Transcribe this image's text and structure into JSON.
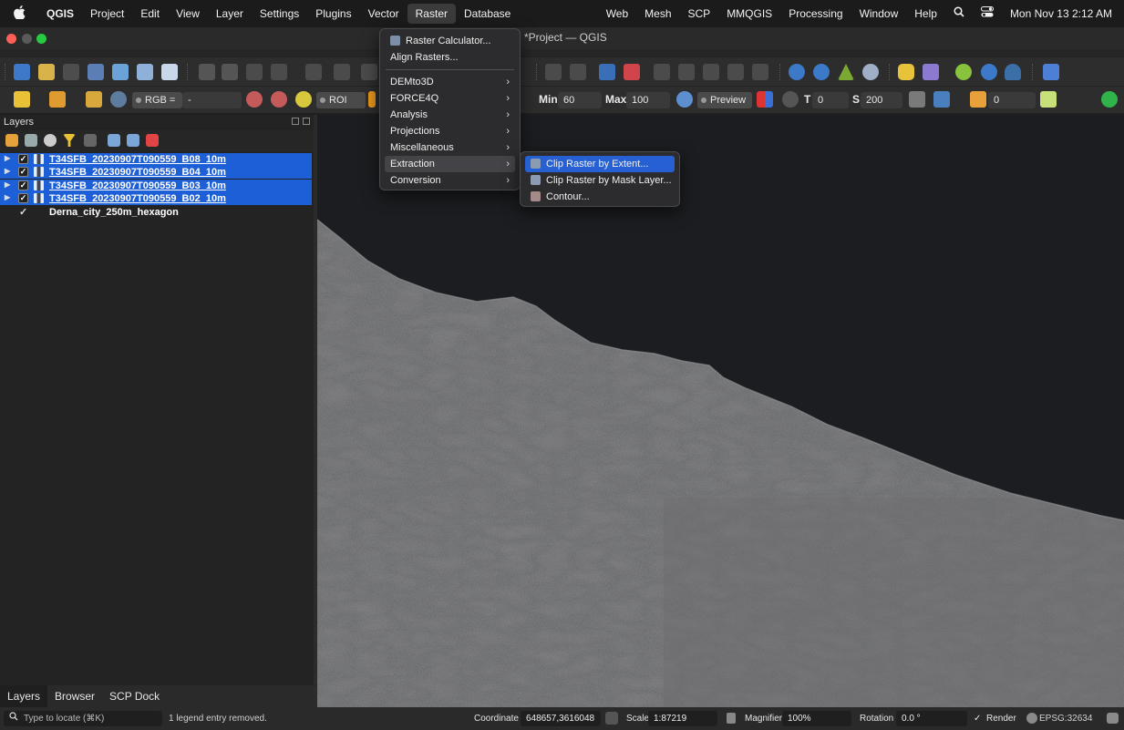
{
  "menubar": {
    "apple": "",
    "app": "QGIS",
    "items": [
      "Project",
      "Edit",
      "View",
      "Layer",
      "Settings",
      "Plugins",
      "Vector",
      "Raster",
      "Database"
    ],
    "right_items": [
      "Web",
      "Mesh",
      "SCP",
      "MMQGIS",
      "Processing",
      "Window",
      "Help"
    ],
    "clock": "Mon Nov 13  2:12 AM"
  },
  "window": {
    "title": "*Project — QGIS"
  },
  "toolbar3": {
    "rgb_label": "RGB =",
    "rgb_value": "-",
    "roi_label": "ROI",
    "min_label": "Min",
    "min_value": "60",
    "max_label": "Max",
    "max_value": "100",
    "preview_label": "Preview",
    "t_label": "T",
    "t_value": "0",
    "s_label": "S",
    "s_value": "200",
    "last_value": "0"
  },
  "layers_panel": {
    "title": "Layers",
    "layers": [
      {
        "name": "T34SFB_20230907T090559_B08_10m",
        "selected": true
      },
      {
        "name": "T34SFB_20230907T090559_B04_10m",
        "selected": true
      },
      {
        "name": "T34SFB_20230907T090559_B03_10m",
        "selected": true
      },
      {
        "name": "T34SFB_20230907T090559_B02_10m",
        "selected": true
      },
      {
        "name": "Derna_city_250m_hexagon",
        "selected": false
      }
    ],
    "tabs": [
      "Layers",
      "Browser",
      "SCP Dock"
    ]
  },
  "raster_menu": {
    "items": [
      {
        "label": "Raster Calculator...",
        "sub": false
      },
      {
        "label": "Align Rasters...",
        "sub": false
      },
      {
        "label": "DEMto3D",
        "sub": true
      },
      {
        "label": "FORCE4Q",
        "sub": true
      },
      {
        "label": "Analysis",
        "sub": true
      },
      {
        "label": "Projections",
        "sub": true
      },
      {
        "label": "Miscellaneous",
        "sub": true
      },
      {
        "label": "Extraction",
        "sub": true
      },
      {
        "label": "Conversion",
        "sub": true
      }
    ],
    "highlighted": "Extraction"
  },
  "extraction_submenu": {
    "items": [
      {
        "label": "Clip Raster by Extent..."
      },
      {
        "label": "Clip Raster by Mask Layer..."
      },
      {
        "label": "Contour..."
      }
    ],
    "highlighted": "Clip Raster by Extent..."
  },
  "statusbar": {
    "locate_placeholder": "Type to locate (⌘K)",
    "message": "1 legend entry removed.",
    "coordinate_label": "Coordinate",
    "coordinate_value": "648657,3616048",
    "scale_label": "Scale",
    "scale_value": "1:87219",
    "magnifier_label": "Magnifier",
    "magnifier_value": "100%",
    "rotation_label": "Rotation",
    "rotation_value": "0.0 °",
    "render_label": "Render",
    "crs": "EPSG:32634"
  },
  "colors": {
    "accent": "#1d5fd6",
    "menu_highlight": "#2760d3"
  }
}
